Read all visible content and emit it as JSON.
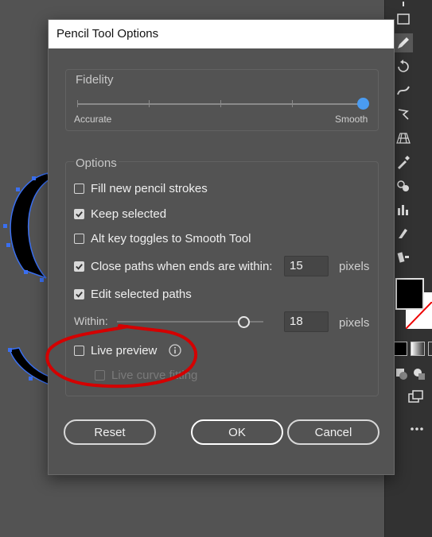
{
  "dialog": {
    "title": "Pencil Tool Options",
    "fidelity": {
      "label": "Fidelity",
      "min_label": "Accurate",
      "max_label": "Smooth",
      "value_fraction": 1.0
    },
    "options": {
      "label": "Options",
      "fill_new_strokes": {
        "label": "Fill new pencil strokes",
        "checked": false
      },
      "keep_selected": {
        "label": "Keep selected",
        "checked": true
      },
      "alt_toggle": {
        "label": "Alt key toggles to Smooth Tool",
        "checked": false
      },
      "close_paths": {
        "label": "Close paths when ends are within:",
        "checked": true,
        "value": "15",
        "unit": "pixels"
      },
      "edit_selected": {
        "label": "Edit selected paths",
        "checked": true
      },
      "within": {
        "label": "Within:",
        "value": "18",
        "unit": "pixels",
        "slider_fraction": 0.88
      },
      "live_preview": {
        "label": "Live preview",
        "checked": false
      },
      "live_curve_fitting": {
        "label": "Live curve fitting",
        "checked": false,
        "enabled": false
      }
    },
    "buttons": {
      "reset": "Reset",
      "ok": "OK",
      "cancel": "Cancel"
    }
  },
  "toolbar": {
    "icons": [
      "select-tool-icon",
      "rectangle-tool-icon",
      "pencil-tool-icon",
      "rotate-tool-icon",
      "warp-tool-icon",
      "free-transform-icon",
      "perspective-grid-icon",
      "eyedropper-icon",
      "blend-tool-icon",
      "graph-tool-icon",
      "slice-tool-icon",
      "hand-tool-icon"
    ],
    "fill_color": "#000000",
    "stroke_color": "#ffffff"
  },
  "colors": {
    "accent": "#4a9cf2",
    "annotation": "#d40000",
    "dialog_bg": "#535353"
  }
}
